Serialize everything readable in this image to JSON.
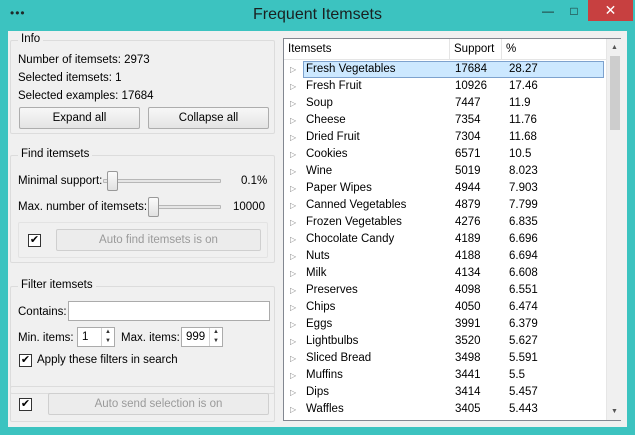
{
  "window": {
    "title": "Frequent Itemsets",
    "sysmenu": "•••",
    "min": "—",
    "max": "□",
    "close": "✕"
  },
  "info": {
    "title": "Info",
    "num_itemsets": "Number of itemsets: 2973",
    "selected_itemsets": "Selected itemsets: 1",
    "selected_examples": "Selected examples: 17684",
    "expand_all": "Expand all",
    "collapse_all": "Collapse all"
  },
  "find": {
    "title": "Find itemsets",
    "min_support_label": "Minimal support:",
    "min_support_value": "0.1%",
    "max_itemsets_label": "Max. number of itemsets:",
    "max_itemsets_value": "10000",
    "auto_find_checked": true,
    "auto_find_label": "Auto find itemsets is on",
    "min_support_level": 0.0,
    "max_itemsets_level": 0.55
  },
  "filter": {
    "title": "Filter itemsets",
    "contains_label": "Contains:",
    "contains_value": "",
    "min_items_label": "Min. items:",
    "min_items_value": "1",
    "max_items_label": "Max. items:",
    "max_items_value": "999",
    "apply_filters_checked": true,
    "apply_filters_label": "Apply these filters in search"
  },
  "send": {
    "auto_send_checked": true,
    "auto_send_label": "Auto send selection is on"
  },
  "table": {
    "columns": [
      "Itemsets",
      "Support",
      "%"
    ],
    "rows": [
      [
        "Fresh Vegetables",
        "17684",
        "28.27"
      ],
      [
        "Fresh Fruit",
        "10926",
        "17.46"
      ],
      [
        "Soup",
        "7447",
        "11.9"
      ],
      [
        "Cheese",
        "7354",
        "11.76"
      ],
      [
        "Dried Fruit",
        "7304",
        "11.68"
      ],
      [
        "Cookies",
        "6571",
        "10.5"
      ],
      [
        "Wine",
        "5019",
        "8.023"
      ],
      [
        "Paper Wipes",
        "4944",
        "7.903"
      ],
      [
        "Canned Vegetables",
        "4879",
        "7.799"
      ],
      [
        "Frozen Vegetables",
        "4276",
        "6.835"
      ],
      [
        "Chocolate Candy",
        "4189",
        "6.696"
      ],
      [
        "Nuts",
        "4188",
        "6.694"
      ],
      [
        "Milk",
        "4134",
        "6.608"
      ],
      [
        "Preserves",
        "4098",
        "6.551"
      ],
      [
        "Chips",
        "4050",
        "6.474"
      ],
      [
        "Eggs",
        "3991",
        "6.379"
      ],
      [
        "Lightbulbs",
        "3520",
        "5.627"
      ],
      [
        "Sliced Bread",
        "3498",
        "5.591"
      ],
      [
        "Muffins",
        "3441",
        "5.5"
      ],
      [
        "Dips",
        "3414",
        "5.457"
      ],
      [
        "Waffles",
        "3405",
        "5.443"
      ]
    ],
    "selected_row": 0,
    "expand_icon": "▷",
    "scroll_up": "▲",
    "scroll_down": "▼"
  }
}
